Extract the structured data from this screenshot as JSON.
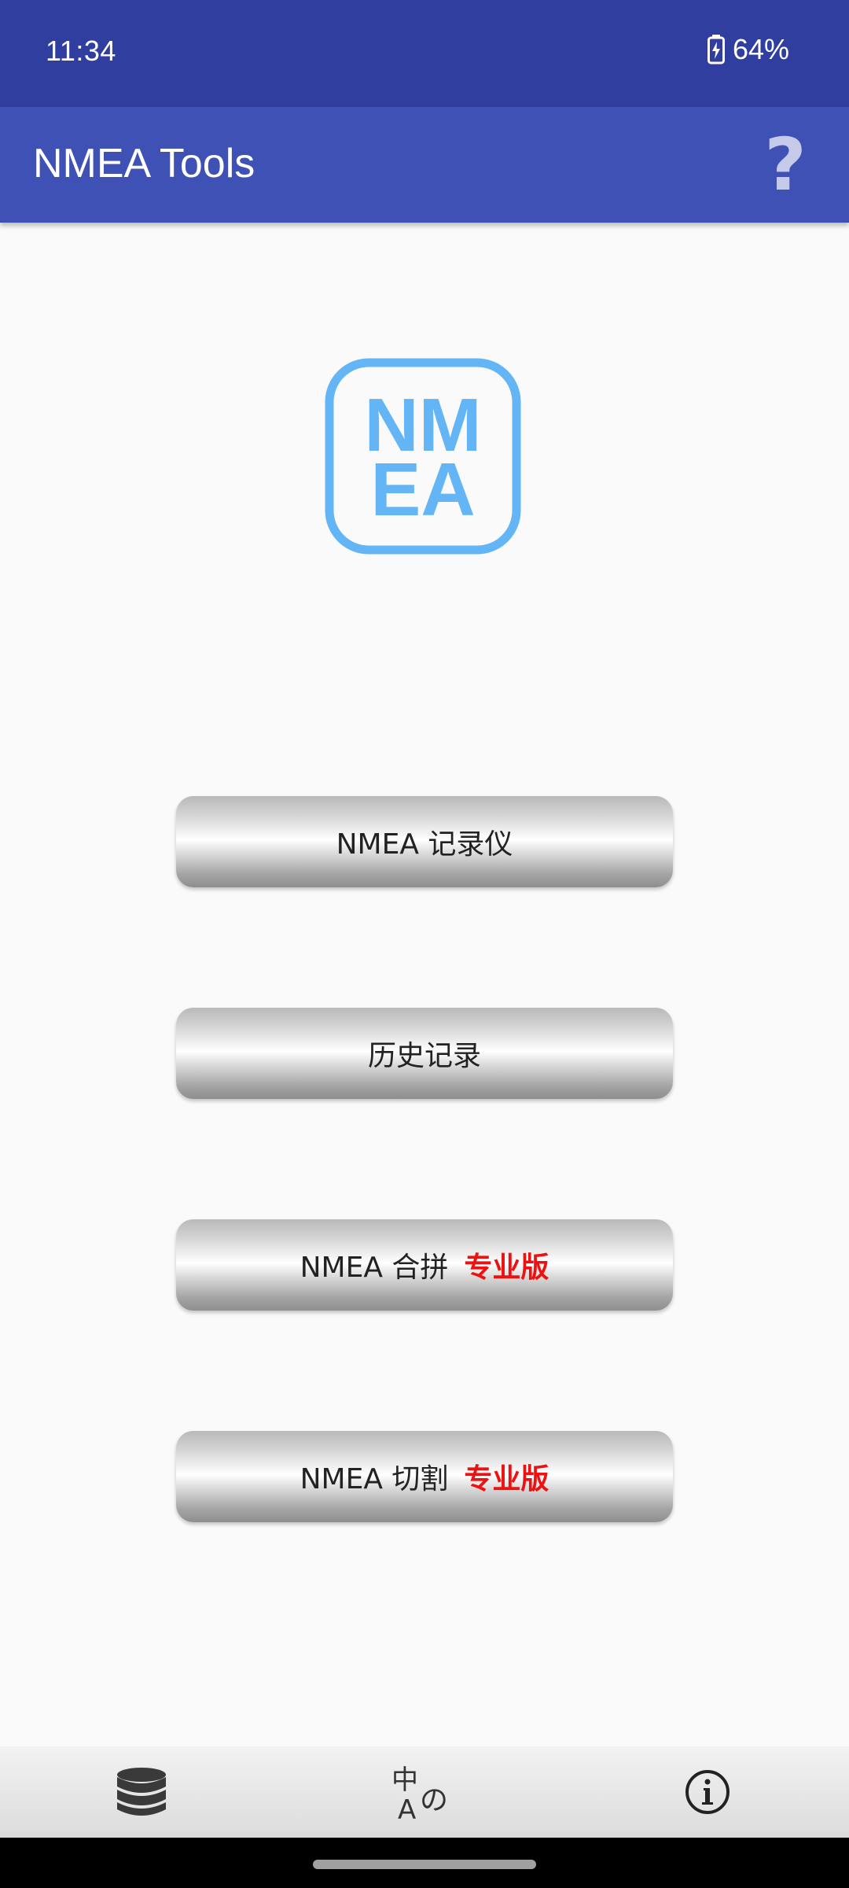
{
  "status_bar": {
    "time": "11:34",
    "battery": "64%"
  },
  "app_bar": {
    "title": "NMEA Tools",
    "help_label": "?"
  },
  "logo": {
    "line1": "NM",
    "line2": "EA",
    "color": "#64b5f6"
  },
  "buttons": [
    {
      "label": "NMEA 记录仪",
      "badge": ""
    },
    {
      "label": "历史记录",
      "badge": ""
    },
    {
      "label": "NMEA 合拼",
      "badge": "专业版"
    },
    {
      "label": "NMEA 切割",
      "badge": "专业版"
    }
  ],
  "bottom_bar": {
    "icons": [
      "database-icon",
      "language-icon",
      "info-icon"
    ]
  },
  "colors": {
    "status_bar": "#303f9f",
    "app_bar": "#3f51b5",
    "pro_badge": "#ee1111"
  }
}
